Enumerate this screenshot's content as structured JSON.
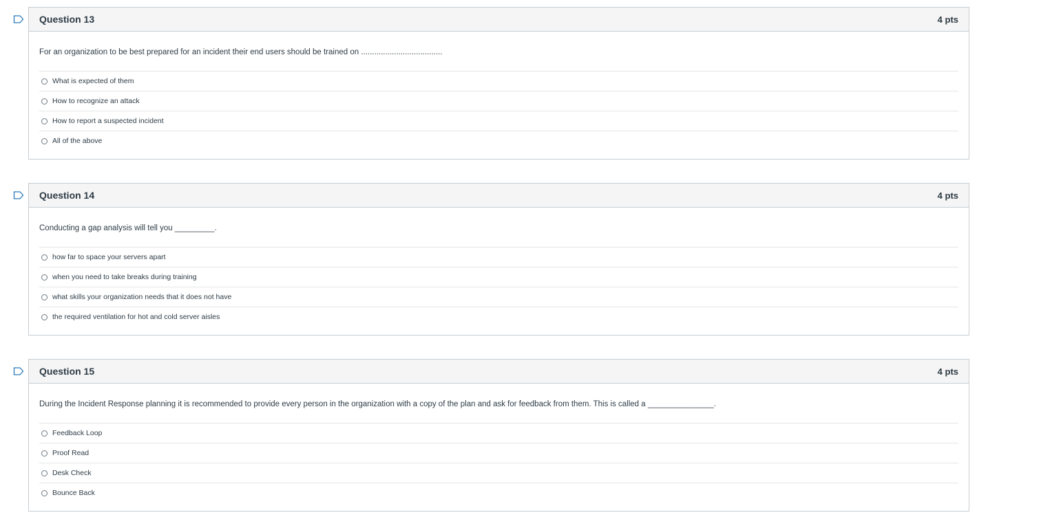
{
  "questions": [
    {
      "title": "Question 13",
      "points": "4 pts",
      "text": "For an organization to be best prepared for an incident their end users should be trained on .....................................",
      "answers": [
        "What is expected of them",
        "How to recognize an attack",
        "How to report a suspected incident",
        "All of the above"
      ]
    },
    {
      "title": "Question 14",
      "points": "4 pts",
      "text": "Conducting a gap analysis will tell you _________.",
      "answers": [
        "how far to space your servers apart",
        "when you need to take breaks during training",
        "what skills your organization needs that it does not have",
        "the required ventilation for hot and cold server aisles"
      ]
    },
    {
      "title": "Question 15",
      "points": "4 pts",
      "text": "During the Incident Response planning it is recommended to provide every person in the organization with a copy of the plan and ask for feedback from them. This is called a _______________.",
      "answers": [
        "Feedback Loop",
        "Proof Read",
        "Desk Check",
        "Bounce Back"
      ]
    }
  ],
  "icons": {
    "flag": "flag-question-icon"
  },
  "colors": {
    "text": "#2d3b45",
    "border": "#c7cdd1",
    "header_bg": "#f5f5f5"
  }
}
